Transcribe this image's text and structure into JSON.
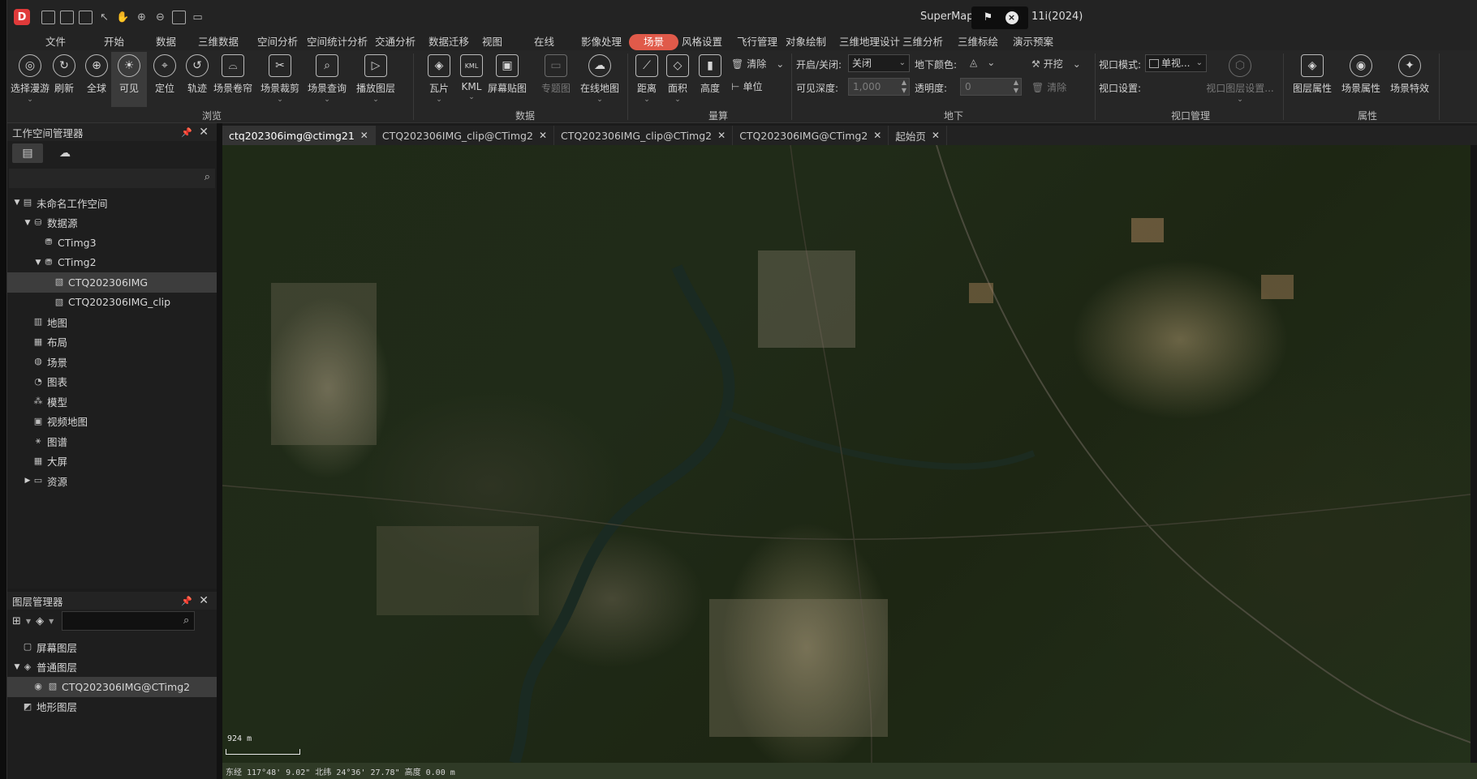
{
  "title_bar": {
    "app_title": "SuperMap",
    "version": "11i(2024)",
    "quick_access": [
      "save-icon",
      "save-as-icon",
      "workspace-icon",
      "select-icon",
      "pan-icon",
      "zoom-in-icon",
      "zoom-out-icon",
      "full-extent-icon",
      "open-folder-icon"
    ]
  },
  "menu": {
    "items": [
      "文件",
      "开始",
      "数据",
      "三维数据",
      "空间分析",
      "空间统计分析",
      "交通分析",
      "数据迁移",
      "视图",
      "在线",
      "影像处理",
      "场景",
      "风格设置",
      "飞行管理",
      "对象绘制",
      "三维地理设计",
      "三维分析",
      "三维标绘",
      "演示预案"
    ],
    "active": "场景"
  },
  "ribbon": {
    "browse": {
      "buttons": [
        "选择漫游",
        "刷新",
        "全球",
        "可见",
        "定位",
        "轨迹",
        "场景卷帘",
        "场景裁剪",
        "场景查询",
        "播放图层"
      ],
      "group_label": "浏览"
    },
    "data": {
      "buttons": [
        "瓦片",
        "KML",
        "屏幕贴图",
        "专题图",
        "在线地图"
      ],
      "group_label": "数据"
    },
    "measure": {
      "buttons": [
        "距离",
        "面积",
        "高度"
      ],
      "clear_label": "清除",
      "unit_label": "单位",
      "group_label": "量算"
    },
    "underground": {
      "toggle_label": "开启/关闭:",
      "toggle_value": "关闭",
      "color_label": "地下颜色:",
      "excavate_label": "开挖",
      "depth_label": "可见深度:",
      "depth_value": "1,000",
      "transparency_label": "透明度:",
      "transparency_value": "0",
      "clear_label": "清除",
      "group_label": "地下"
    },
    "viewport": {
      "mode_label": "视口模式:",
      "mode_value": "单视...",
      "settings_label": "视口设置:",
      "layer_settings_label": "视口图层设置...",
      "group_label": "视口管理"
    },
    "properties": {
      "buttons": [
        "图层属性",
        "场景属性",
        "场景特效"
      ],
      "group_label": "属性"
    }
  },
  "workspace_panel": {
    "title": "工作空间管理器",
    "tree": [
      {
        "label": "未命名工作空间",
        "level": 0,
        "expander": "▼",
        "icon": "workspace-icon"
      },
      {
        "label": "数据源",
        "level": 1,
        "expander": "▼",
        "icon": "datasources-icon"
      },
      {
        "label": "CTimg3",
        "level": 2,
        "expander": "",
        "icon": "datasource-icon"
      },
      {
        "label": "CTimg2",
        "level": 2,
        "expander": "▼",
        "icon": "datasource-icon"
      },
      {
        "label": "CTQ202306IMG",
        "level": 3,
        "expander": "",
        "icon": "raster-icon",
        "selected": true
      },
      {
        "label": "CTQ202306IMG_clip",
        "level": 3,
        "expander": "",
        "icon": "raster-icon"
      },
      {
        "label": "地图",
        "level": 1,
        "expander": "",
        "icon": "map-icon"
      },
      {
        "label": "布局",
        "level": 1,
        "expander": "",
        "icon": "layout-icon"
      },
      {
        "label": "场景",
        "level": 1,
        "expander": "",
        "icon": "scene-icon"
      },
      {
        "label": "图表",
        "level": 1,
        "expander": "",
        "icon": "chart-icon"
      },
      {
        "label": "模型",
        "level": 1,
        "expander": "",
        "icon": "model-icon"
      },
      {
        "label": "视频地图",
        "level": 1,
        "expander": "",
        "icon": "video-map-icon"
      },
      {
        "label": "图谱",
        "level": 1,
        "expander": "",
        "icon": "graph-icon"
      },
      {
        "label": "大屏",
        "level": 1,
        "expander": "",
        "icon": "dashboard-icon"
      },
      {
        "label": "资源",
        "level": 1,
        "expander": "▶",
        "icon": "folder-icon"
      }
    ]
  },
  "layer_panel": {
    "title": "图层管理器",
    "tree": [
      {
        "label": "屏幕图层",
        "level": 0,
        "expander": "",
        "icon": "screen-layer-icon"
      },
      {
        "label": "普通图层",
        "level": 0,
        "expander": "▼",
        "icon": "layers-icon"
      },
      {
        "label": "CTQ202306IMG@CTimg2",
        "level": 1,
        "expander": "",
        "icon": "raster-icon",
        "selected": true,
        "visible_eye": true
      },
      {
        "label": "地形图层",
        "level": 0,
        "expander": "",
        "icon": "terrain-layer-icon"
      }
    ]
  },
  "doc_tabs": [
    {
      "label": "ctq202306img@ctimg21",
      "active": true
    },
    {
      "label": "CTQ202306IMG_clip@CTimg2",
      "active": false
    },
    {
      "label": "CTQ202306IMG_clip@CTimg2",
      "active": false
    },
    {
      "label": "CTQ202306IMG@CTimg2",
      "active": false
    },
    {
      "label": "起始页",
      "active": false
    }
  ],
  "map_view": {
    "scale_text": "924 m",
    "status_text": "东经 117°48' 9.02\"   北纬 24°36' 27.78\"   高度 0.00 m"
  },
  "colors": {
    "accent": "#e05a4a",
    "background": "#1b1b1b",
    "panel": "#1e1e1e"
  }
}
